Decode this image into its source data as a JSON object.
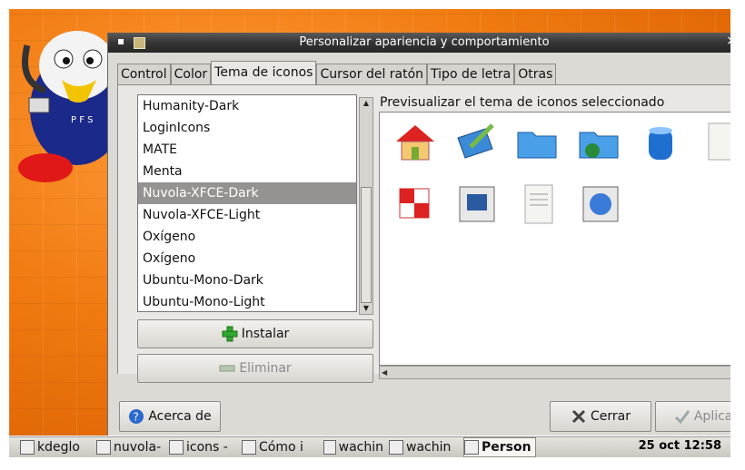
{
  "window": {
    "title": "Personalizar apariencia y comportamiento",
    "menu_symbol": "▪",
    "close_symbol": "×"
  },
  "tabs": [
    {
      "label": "Control",
      "active": false
    },
    {
      "label": "Color",
      "active": false
    },
    {
      "label": "Tema de iconos",
      "active": true
    },
    {
      "label": "Cursor del ratón",
      "active": false
    },
    {
      "label": "Tipo de letra",
      "active": false
    },
    {
      "label": "Otras",
      "active": false
    }
  ],
  "theme_list": {
    "items": [
      "Humanity-Dark",
      "LoginIcons",
      "MATE",
      "Menta",
      "Nuvola-XFCE-Dark",
      "Nuvola-XFCE-Light",
      "Oxígeno",
      "Oxígeno",
      "Ubuntu-Mono-Dark",
      "Ubuntu-Mono-Light"
    ],
    "selected": "Nuvola-XFCE-Dark"
  },
  "preview": {
    "label": "Previsualizar el tema de iconos seleccionado",
    "icons": [
      "home-icon",
      "desktop-edit-icon",
      "folder-icon",
      "network-folder-icon",
      "trash-icon",
      "document-icon",
      "checker-icon",
      "image-icon",
      "text-file-icon",
      "globe-icon"
    ]
  },
  "buttons": {
    "install": "Instalar",
    "remove": "Eliminar",
    "about": "Acerca de",
    "close": "Cerrar",
    "apply": "Aplicar"
  },
  "taskbar": {
    "tasks": [
      {
        "label": "kdeglo",
        "icon": "notepad-icon"
      },
      {
        "label": "nuvola-",
        "icon": "folder-icon"
      },
      {
        "label": "icons -",
        "icon": "folder-icon"
      },
      {
        "label": "Cómo i",
        "icon": "document-icon"
      },
      {
        "label": "wachin",
        "icon": "folder-icon"
      },
      {
        "label": "wachin",
        "icon": "terminal-icon"
      },
      {
        "label": "Person",
        "icon": "appearance-icon",
        "active": true
      }
    ],
    "clock": "25 oct 12:58"
  },
  "colors": {
    "selection": "#949391",
    "accent_orange": "#f07a10"
  }
}
